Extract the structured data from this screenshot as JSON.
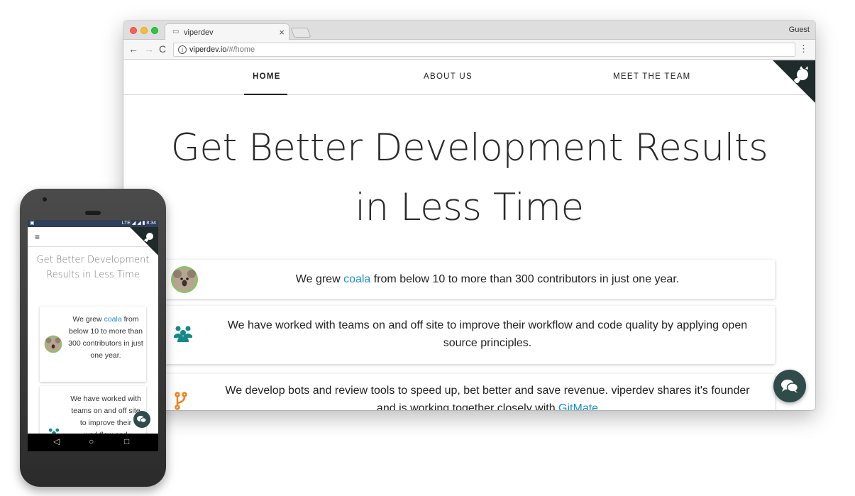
{
  "browser": {
    "tab_title": "viperdev",
    "tab_close_glyph": "×",
    "profile_label": "Guest",
    "url_host": "viperdev.io",
    "url_path": "/#/home",
    "back_glyph": "←",
    "forward_glyph": "→",
    "reload_glyph": "C",
    "info_glyph": "i",
    "menu_glyph": "⋮"
  },
  "site": {
    "nav": {
      "home": "HOME",
      "about": "ABOUT US",
      "team": "MEET THE TEAM"
    },
    "hero_line1": "Get Better Development Results",
    "hero_line2": "in Less Time",
    "cards": [
      {
        "pre": "We grew ",
        "link": "coala",
        "post": " from below 10 to more than 300 contributors in just one year.",
        "icon": "koala-icon"
      },
      {
        "text": "We have worked with teams on and off site to improve their workflow and code quality by applying open source principles.",
        "icon": "people-icon"
      },
      {
        "text": "We develop bots and review tools to speed up, bet better and save revenue. viperdev shares it's founder and is working together closely with ",
        "link": "GitMate",
        "icon": "fork-icon"
      }
    ],
    "accent_color": "#1a8fcf",
    "teal_color": "#138a8a",
    "fab_color": "#2f4b4a"
  },
  "phone": {
    "status_left": "▣",
    "status_right": "LTE ◢ ◢ ▮ 8:34",
    "menu_glyph": "≡",
    "hero": "Get Better Development Results in Less Time",
    "card1_pre": "We grew ",
    "card1_link": "coala",
    "card1_post": " from below 10 to more than 300 contributors in just one year.",
    "card2_text": "We have worked with teams on and off site to improve their workflow and",
    "nav_back": "◁",
    "nav_home": "○",
    "nav_recent": "□"
  }
}
